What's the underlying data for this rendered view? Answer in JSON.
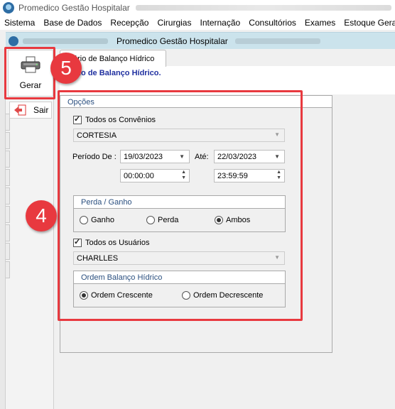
{
  "app": {
    "title": "Promedico Gestão Hospitalar"
  },
  "menu": [
    {
      "label": "Sistema",
      "u": ""
    },
    {
      "label": "Base de Dados",
      "u": ""
    },
    {
      "label": "Recepção",
      "u": ""
    },
    {
      "label": "Cirurgias",
      "u": ""
    },
    {
      "label": "Internação",
      "u": ""
    },
    {
      "label": "Consultórios",
      "u": ""
    },
    {
      "label": "Exames",
      "u": ""
    },
    {
      "label": "Estoque Geral",
      "u": ""
    }
  ],
  "child": {
    "title": "Promedico Gestão Hospitalar"
  },
  "toolbar": {
    "gerar": "Gerar",
    "sair": "Sair"
  },
  "callouts": {
    "five": "5",
    "four": "4"
  },
  "tab": {
    "label": "ório de Balanço Hídrico"
  },
  "report": {
    "title": "ório de Balanço Hídrico."
  },
  "options": {
    "header": "Opções",
    "todos_convenios": "Todos os Convênios",
    "convenio": "CORTESIA",
    "periodo_de": "Período De :",
    "ate": "Até:",
    "date_from": "19/03/2023",
    "date_to": "22/03/2023",
    "time_from": "00:00:00",
    "time_to": "23:59:59",
    "perda_ganho": {
      "title": "Perda / Ganho",
      "ganho": "Ganho",
      "perda": "Perda",
      "ambos": "Ambos",
      "selected": "Ambos"
    },
    "todos_usuarios": "Todos os Usuários",
    "usuario": "CHARLLES",
    "ordem": {
      "title": "Ordem Balanço Hídrico",
      "crescente": "Ordem Crescente",
      "decrescente": "Ordem Decrescente",
      "selected": "Ordem Crescente"
    }
  },
  "colors": {
    "highlight": "#e8393f",
    "group_title": "#2a4f7f",
    "report_title": "#2030a0"
  }
}
